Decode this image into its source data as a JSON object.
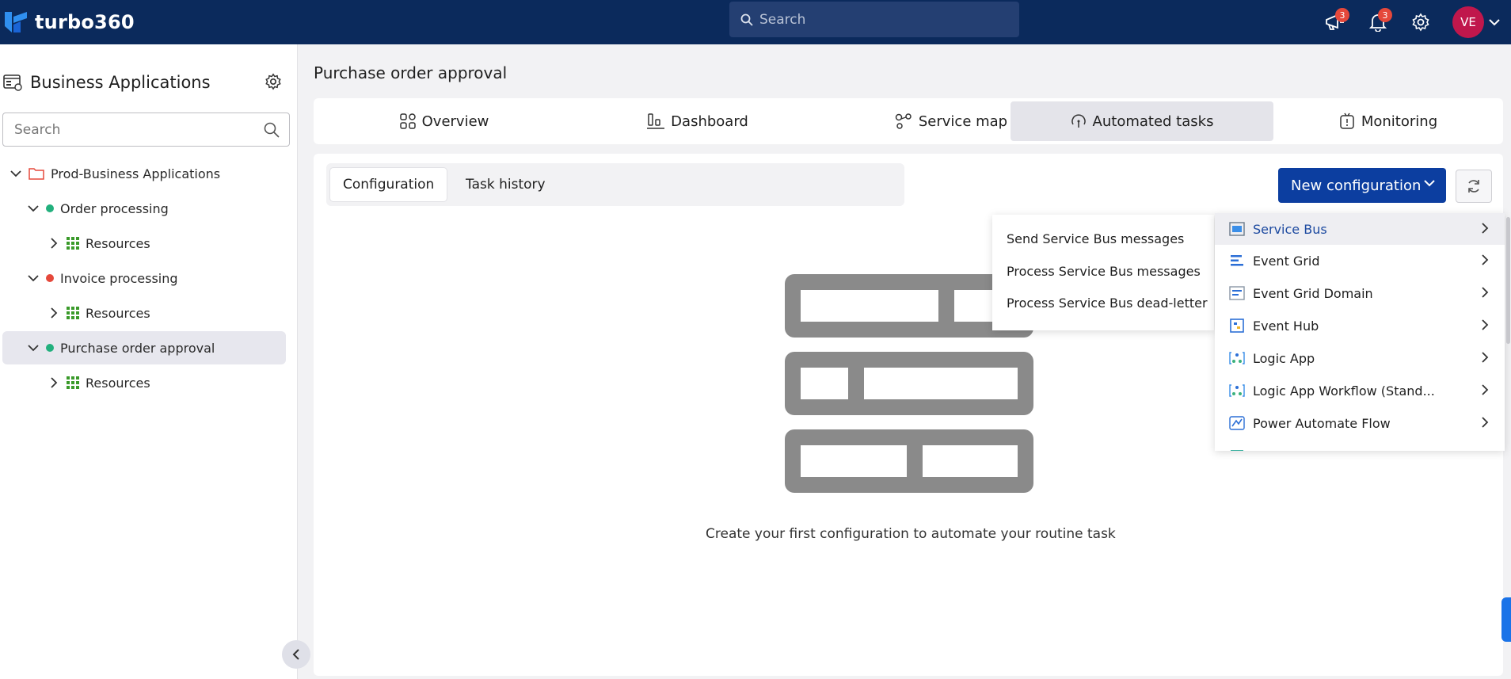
{
  "app": {
    "logo_text": "turbo360",
    "search_placeholder": "Search"
  },
  "topbar": {
    "announcements_badge": "3",
    "notifications_badge": "3",
    "avatar_initials": "VE"
  },
  "sidebar": {
    "title": "Business Applications",
    "search_placeholder": "Search",
    "tree": {
      "root": "Prod-Business Applications",
      "apps": [
        {
          "label": "Order processing",
          "status_color": "#22b07d",
          "child": "Resources"
        },
        {
          "label": "Invoice processing",
          "status_color": "#e5483b",
          "child": "Resources"
        },
        {
          "label": "Purchase order approval",
          "status_color": "#22b07d",
          "child": "Resources"
        }
      ]
    }
  },
  "main": {
    "page_title": "Purchase order approval",
    "tabs": [
      "Overview",
      "Dashboard",
      "Service map",
      "Automated tasks",
      "Monitoring"
    ],
    "active_tab": "Automated tasks",
    "subtabs": [
      "Configuration",
      "Task history"
    ],
    "new_configuration_label": "New configuration",
    "empty_message": "Create your first configuration to automate your routine task"
  },
  "dropdown": {
    "items": [
      "Service Bus",
      "Event Grid",
      "Event Grid Domain",
      "Event Hub",
      "Logic App",
      "Logic App Workflow (Stand...",
      "Power Automate Flow"
    ],
    "highlighted": "Service Bus",
    "submenu": [
      "Send Service Bus messages",
      "Process Service Bus messages",
      "Process Service Bus dead-letter"
    ]
  },
  "colors": {
    "topbar": "#0b2a5c",
    "accent": "#0c3ea0",
    "badge": "#e5483b",
    "avatar": "#c0174c"
  }
}
